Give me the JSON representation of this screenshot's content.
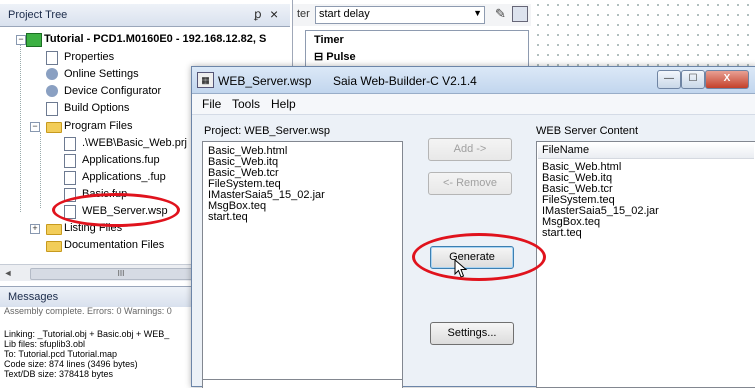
{
  "project_tree": {
    "title": "Project Tree",
    "pin_glyph": "ꝑ",
    "close_glyph": "×",
    "items": [
      {
        "label": "Tutorial - PCD1.M0160E0 - 192.168.12.82, S",
        "icon": "plc-icon",
        "bold": true
      },
      {
        "label": "Properties",
        "icon": "properties-icon"
      },
      {
        "label": "Online Settings",
        "icon": "online-settings-icon"
      },
      {
        "label": "Device Configurator",
        "icon": "device-configurator-icon"
      },
      {
        "label": "Build Options",
        "icon": "build-options-icon"
      },
      {
        "label": "Program Files",
        "icon": "folder-icon"
      },
      {
        "label": ".\\WEB\\Basic_Web.prj",
        "icon": "file-icon"
      },
      {
        "label": "Applications.fup",
        "icon": "file-icon"
      },
      {
        "label": "Applications_.fup",
        "icon": "file-icon"
      },
      {
        "label": "Basic.fup",
        "icon": "file-icon"
      },
      {
        "label": "WEB_Server.wsp",
        "icon": "file-icon"
      },
      {
        "label": "Listing Files",
        "icon": "folder-icon"
      },
      {
        "label": "Documentation Files",
        "icon": "folder-icon"
      }
    ],
    "scroll_thumb_glyph": "III"
  },
  "messages": {
    "title": "Messages",
    "lines": [
      "Assembly complete. Errors: 0 Warnings: 0",
      "",
      "Linking: _Tutorial.obj + Basic.obj + WEB_",
      "Lib files: sfuplib3.obl",
      "To: Tutorial.pcd Tutorial.map",
      "Code size: 874 lines (3496 bytes)",
      "Text/DB size: 378418 bytes"
    ]
  },
  "editor": {
    "filter_label": "ter",
    "filter_value": "start delay",
    "timer_label": "Timer",
    "pulse_label": "⊟ Pulse"
  },
  "dialog": {
    "title_file": "WEB_Server.wsp",
    "title_app": "Saia Web-Builder-C  V2.1.4",
    "menu": [
      "File",
      "Tools",
      "Help"
    ],
    "project_label": "Project: WEB_Server.wsp",
    "project_files": [
      "Basic_Web.html",
      "Basic_Web.itq",
      "Basic_Web.tcr",
      "FileSystem.teq",
      "IMasterSaia5_15_02.jar",
      "MsgBox.teq",
      "start.teq"
    ],
    "server_label": "WEB Server Content",
    "server_column": "FileName",
    "server_files": [
      "Basic_Web.html",
      "Basic_Web.itq",
      "Basic_Web.tcr",
      "FileSystem.teq",
      "IMasterSaia5_15_02.jar",
      "MsgBox.teq",
      "start.teq"
    ],
    "buttons": {
      "add": "Add ->",
      "remove": "<- Remove",
      "generate": "Generate",
      "settings": "Settings..."
    },
    "caption_buttons": {
      "minimize": "—",
      "maximize": "☐",
      "close": "X"
    }
  },
  "colors": {
    "highlight_ring": "#e0131d",
    "dialog_bg": "#ecf1f7"
  }
}
